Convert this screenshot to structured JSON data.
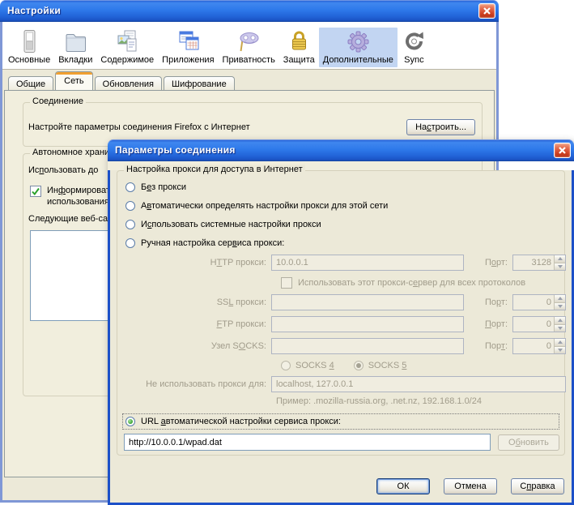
{
  "colors": {
    "titlebar_blue": "#2e79ea",
    "selected_toolbar_bg": "#c2d5f2",
    "active_tab_stripe": "#f0a030",
    "radio_checked_green": "#2f9e2c"
  },
  "window": {
    "title": "Настройки",
    "toolbar": [
      {
        "label": "Основные",
        "icon": "switch-icon",
        "selected": false
      },
      {
        "label": "Вкладки",
        "icon": "folder-icon",
        "selected": false
      },
      {
        "label": "Содержимое",
        "icon": "content-pages-icon",
        "selected": false
      },
      {
        "label": "Приложения",
        "icon": "applications-icon",
        "selected": false
      },
      {
        "label": "Приватность",
        "icon": "mask-icon",
        "selected": false
      },
      {
        "label": "Защита",
        "icon": "lock-icon",
        "selected": false
      },
      {
        "label": "Дополнительные",
        "icon": "gear-icon",
        "selected": true
      },
      {
        "label": "Sync",
        "icon": "sync-icon",
        "selected": false
      }
    ],
    "tabs": [
      {
        "label": "Общие",
        "active": false
      },
      {
        "label": "Сеть",
        "active": true
      },
      {
        "label": "Обновления",
        "active": false
      },
      {
        "label": "Шифрование",
        "active": false
      }
    ],
    "connection": {
      "title": "Соединение",
      "description": "Настройте параметры соединения Firefox с Интернет",
      "configure": {
        "t": "Настроить...",
        "u": 2
      }
    },
    "offline": {
      "title": "Автономное хранил",
      "use_label": {
        "t": "Использовать до",
        "u": 2
      },
      "inform_line1": {
        "t": "Информироват",
        "u": 2
      },
      "inform_line2": "использования",
      "inform_checked": true,
      "sites_label": "Следующие веб-са"
    }
  },
  "dialog": {
    "title": "Параметры соединения",
    "group_title": "Настройка прокси для доступа в Интернет",
    "radios": [
      {
        "t": "Без прокси",
        "u": 1
      },
      {
        "t": "Автоматически определять настройки прокси для этой сети",
        "u": 1
      },
      {
        "t": "Использовать системные настройки прокси",
        "u": 1
      },
      {
        "t": "Ручная настройка сервиса прокси:",
        "u": 20
      }
    ],
    "rows": [
      {
        "label": {
          "t": "HTTP прокси:",
          "u": 1
        },
        "value": "10.0.0.1",
        "port_label": {
          "t": "Порт:",
          "u": 1
        },
        "port": "3128"
      },
      {
        "label": {
          "t": "SSL прокси:",
          "u": 2
        },
        "value": "",
        "port_label": {
          "t": "Порт:",
          "u": 2
        },
        "port": "0"
      },
      {
        "label": {
          "t": "FTP прокси:",
          "u": 0
        },
        "value": "",
        "port_label": {
          "t": "Порт:",
          "u": 0
        },
        "port": "0"
      },
      {
        "label": {
          "t": "Узел SOCKS:",
          "u": 6
        },
        "value": "",
        "port_label": {
          "t": "Порт:",
          "u": 3
        },
        "port": "0"
      }
    ],
    "all_protocols": {
      "t": "Использовать этот прокси-сервер для всех протоколов",
      "u": 26
    },
    "socks4": {
      "t": "SOCKS 4",
      "u": 6
    },
    "socks5": {
      "t": "SOCKS 5",
      "u": 6
    },
    "no_proxy_label": {
      "t": "Не использовать прокси для:",
      "u": 23
    },
    "no_proxy_value": "localhost, 127.0.0.1",
    "example": "Пример: .mozilla-russia.org, .net.nz, 192.168.1.0/24",
    "url_radio": {
      "t": "URL автоматической настройки сервиса прокси:",
      "u": 4
    },
    "url_value": "http://10.0.0.1/wpad.dat",
    "refresh": {
      "t": "Обновить",
      "u": 1
    },
    "buttons": {
      "ok": "ОК",
      "cancel": "Отмена",
      "help": {
        "t": "Справка",
        "u": 1
      }
    }
  }
}
